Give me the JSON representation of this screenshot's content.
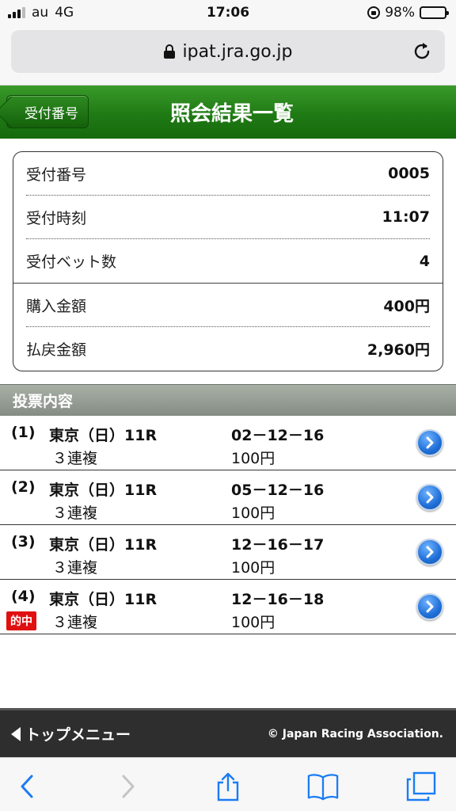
{
  "status_bar": {
    "carrier": "au",
    "network": "4G",
    "time": "17:06",
    "battery": "98%"
  },
  "browser": {
    "url": "ipat.jra.go.jp"
  },
  "header": {
    "back_label": "受付番号",
    "title": "照会結果一覧"
  },
  "summary": {
    "rows": [
      {
        "label": "受付番号",
        "value": "0005"
      },
      {
        "label": "受付時刻",
        "value": "11:07"
      },
      {
        "label": "受付ベット数",
        "value": "4"
      },
      {
        "label": "購入金額",
        "value": "400円"
      },
      {
        "label": "払戻金額",
        "value": "2,960円"
      }
    ]
  },
  "section": {
    "title": "投票内容"
  },
  "bets": [
    {
      "no": "(1)",
      "venue": "東京（日）11R",
      "type": "３連複",
      "combo": "02－12－16",
      "amount": "100円",
      "badge": ""
    },
    {
      "no": "(2)",
      "venue": "東京（日）11R",
      "type": "３連複",
      "combo": "05－12－16",
      "amount": "100円",
      "badge": ""
    },
    {
      "no": "(3)",
      "venue": "東京（日）11R",
      "type": "３連複",
      "combo": "12－16－17",
      "amount": "100円",
      "badge": ""
    },
    {
      "no": "(4)",
      "venue": "東京（日）11R",
      "type": "３連複",
      "combo": "12－16－18",
      "amount": "100円",
      "badge": "的中"
    }
  ],
  "footer": {
    "top_menu": "トップメニュー",
    "copyright": "© Japan Racing Association."
  },
  "colors": {
    "header_green": "#1f7a14",
    "hit_red": "#e01010",
    "detail_blue": "#1f6fd8"
  }
}
